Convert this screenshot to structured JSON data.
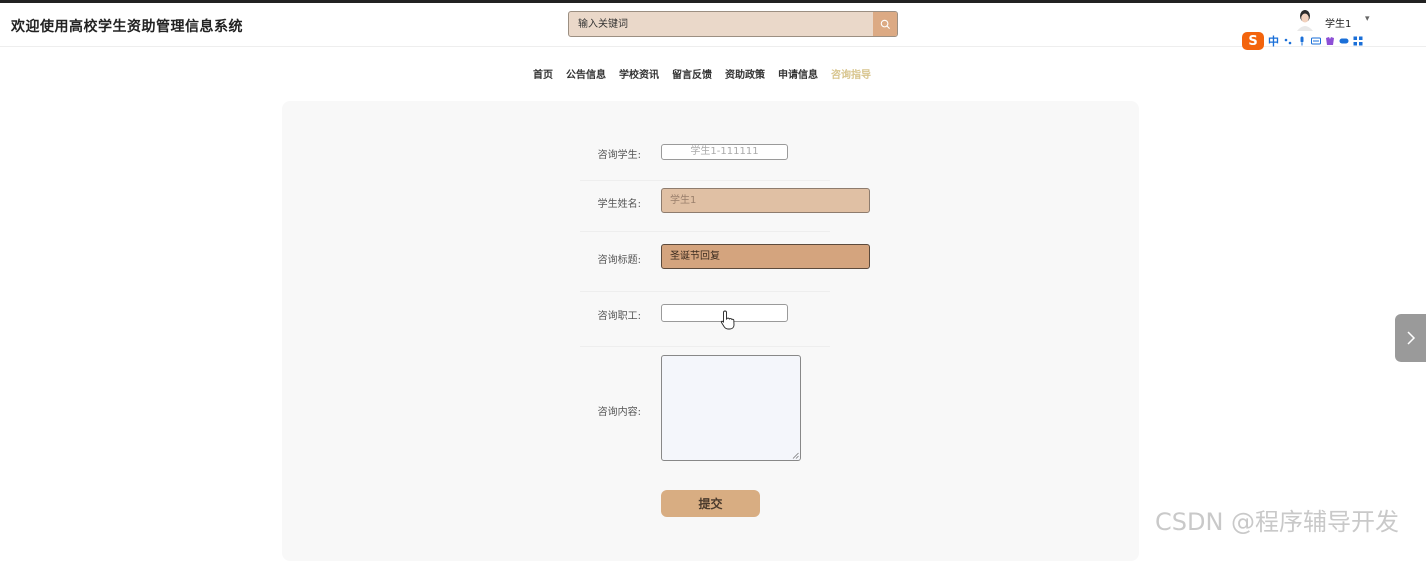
{
  "header": {
    "site_title": "欢迎使用高校学生资助管理信息系统",
    "search_placeholder": "输入关键词",
    "username": "学生1",
    "user_caret": "▾"
  },
  "ime": {
    "logo": "S",
    "mode": "中"
  },
  "nav": {
    "items": [
      "首页",
      "公告信息",
      "学校资讯",
      "留言反馈",
      "资助政策",
      "申请信息",
      "咨询指导"
    ],
    "active": "咨询指导"
  },
  "form": {
    "student": {
      "label": "咨询学生:",
      "value": "学生1-111111"
    },
    "name": {
      "label": "学生姓名:",
      "value": "学生1"
    },
    "title": {
      "label": "咨询标题:",
      "value": "圣诞节回复"
    },
    "staff": {
      "label": "咨询职工:",
      "value": ""
    },
    "content": {
      "label": "咨询内容:",
      "value": ""
    },
    "submit_label": "提交"
  },
  "watermark": "CSDN @程序辅导开发",
  "colors": {
    "accent": "#dcaa84",
    "active_nav": "#d8c58e",
    "name_field_bg": "#e0c0a4",
    "title_field_bg": "#d4a47e",
    "submit_bg": "#d8ad82"
  }
}
